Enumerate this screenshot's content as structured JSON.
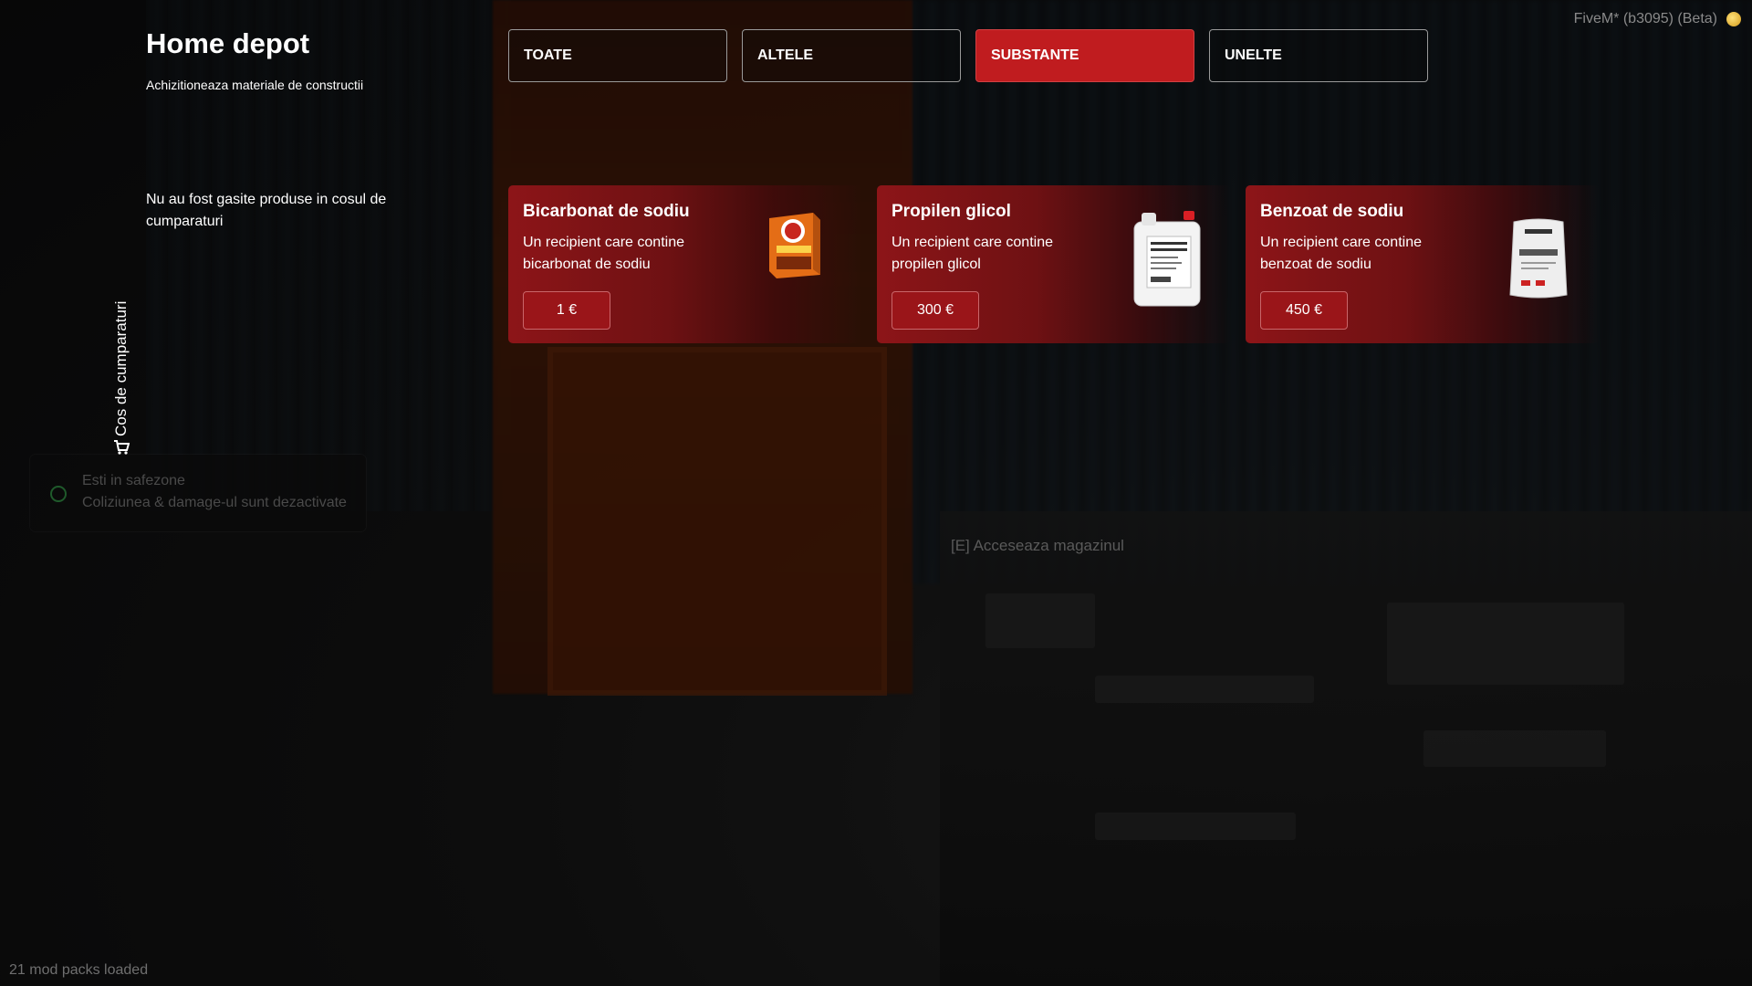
{
  "store": {
    "title": "Home depot",
    "subtitle": "Achizitioneaza materiale de constructii",
    "empty_cart": "Nu au fost gasite produse in cosul de cumparaturi",
    "cart_label": "Cos de cumparaturi"
  },
  "tabs": [
    {
      "label": "TOATE",
      "active": false
    },
    {
      "label": "ALTELE",
      "active": false
    },
    {
      "label": "SUBSTANTE",
      "active": true
    },
    {
      "label": "UNELTE",
      "active": false
    }
  ],
  "products": [
    {
      "name": "Bicarbonat de sodiu",
      "description": "Un recipient care contine bicarbonat de sodiu",
      "price": "1 €",
      "icon": "baking-soda-box-icon"
    },
    {
      "name": "Propilen glicol",
      "description": "Un recipient care contine propilen glicol",
      "price": "300 €",
      "icon": "chemical-jug-icon"
    },
    {
      "name": "Benzoat de sodiu",
      "description": "Un recipient care contine benzoat de sodiu",
      "price": "450 €",
      "icon": "powder-bag-icon"
    }
  ],
  "hud": {
    "fivem": "FiveM* (b3095) (Beta)",
    "mods": "21 mod packs loaded",
    "safezone_title": "Esti in safezone",
    "safezone_sub": "Coliziunea & damage-ul sunt dezactivate",
    "world_prompt": "[E] Acceseaza magazinul"
  },
  "colors": {
    "accent": "#c01c1f",
    "card": "#8d1518",
    "tab_border": "#9a9a9a"
  }
}
